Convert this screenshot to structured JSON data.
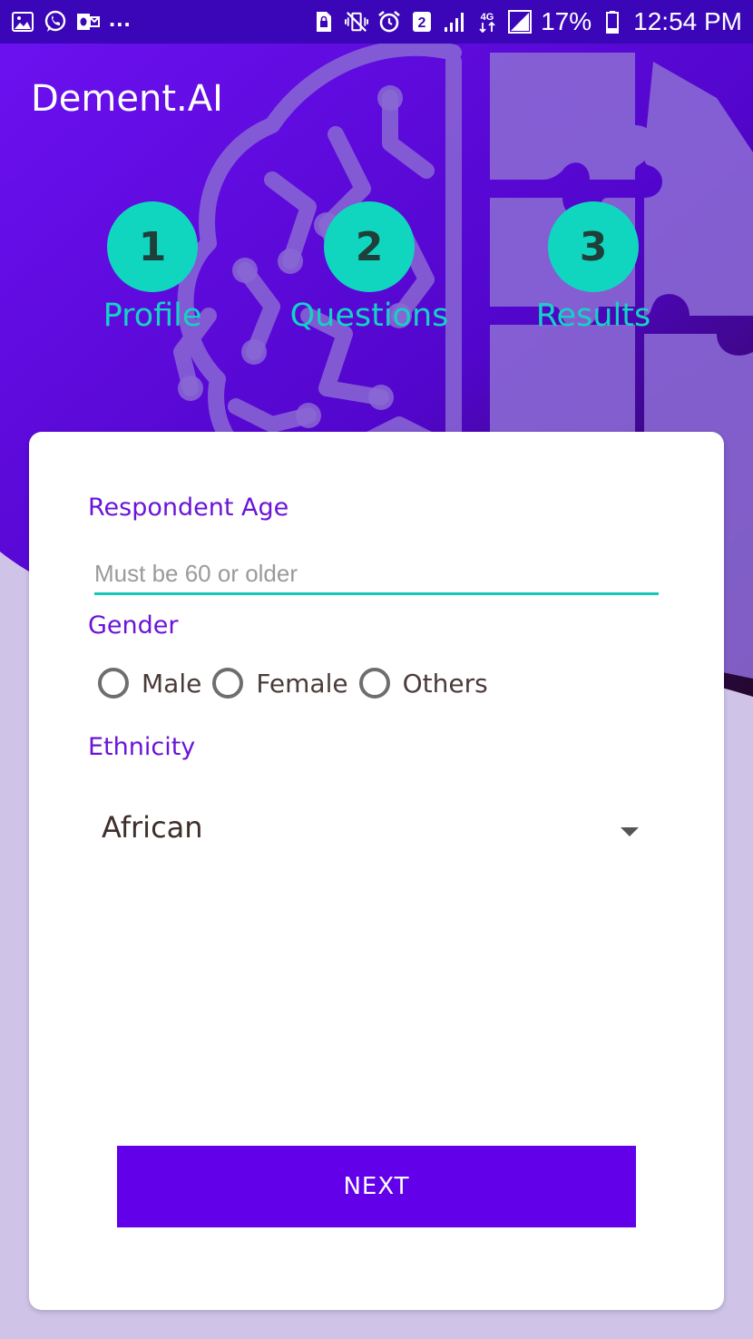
{
  "status_bar": {
    "more": "...",
    "network": "4G",
    "battery": "17%",
    "time": "12:54 PM",
    "sim_slot": "2"
  },
  "app": {
    "title": "Dement.AI"
  },
  "stepper": {
    "steps": [
      {
        "number": "1",
        "label": "Profile"
      },
      {
        "number": "2",
        "label": "Questions"
      },
      {
        "number": "3",
        "label": "Results"
      }
    ]
  },
  "form": {
    "age_label": "Respondent Age",
    "age_value": "",
    "age_placeholder": "Must be 60 or older",
    "gender_label": "Gender",
    "gender_options": [
      "Male",
      "Female",
      "Others"
    ],
    "ethnicity_label": "Ethnicity",
    "ethnicity_value": "African",
    "next_label": "NEXT"
  },
  "colors": {
    "primary": "#6200ea",
    "status_bar": "#3a06b8",
    "accent": "#10d6c0",
    "label": "#6a14d8",
    "page_background": "#cfc4e8"
  },
  "icons": {
    "status_left": [
      "gallery-icon",
      "whatsapp-icon",
      "outlook-icon"
    ],
    "status_right": [
      "sim-lock-icon",
      "vibrate-mute-icon",
      "alarm-icon",
      "sim-two-icon",
      "signal-icon",
      "mobile-data-icon",
      "no-signal-icon",
      "battery-icon"
    ],
    "dropdown": "chevron-down-icon"
  }
}
